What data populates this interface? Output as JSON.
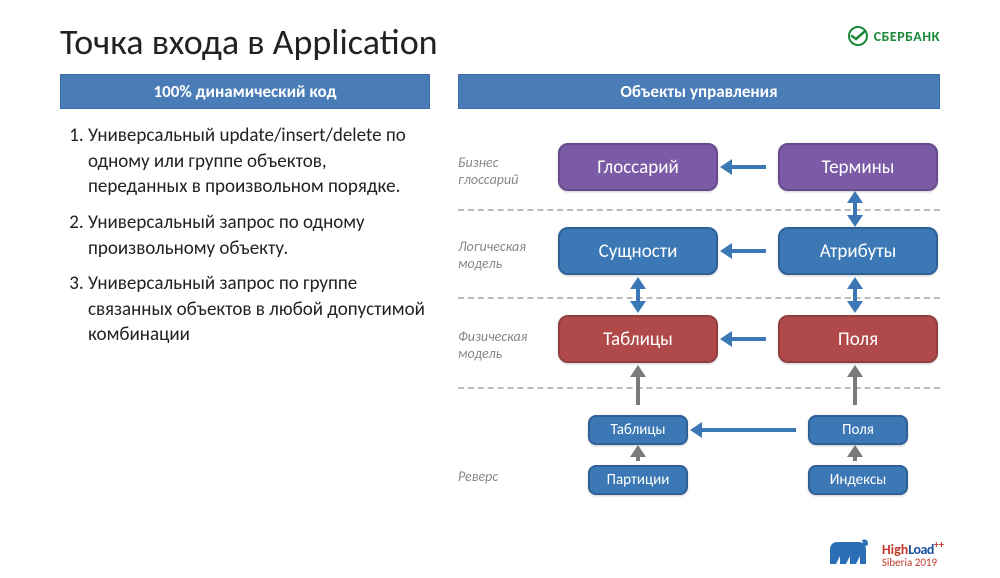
{
  "title": "Точка входа в Application",
  "brand": {
    "name": "СБЕРБАНК"
  },
  "left": {
    "header": "100% динамический код",
    "items": [
      "Универсальный update/insert/delete по одному или группе объектов, переданных в произвольном порядке.",
      "Универсальный запрос по одному произвольному объекту.",
      "Универсальный запрос по группе связанных объектов в любой допустимой комбинации"
    ]
  },
  "right": {
    "header": "Объекты управления",
    "labels": {
      "biz": "Бизнес глоссарий",
      "logical": "Логическая модель",
      "physical": "Физическая модель",
      "reverse": "Реверс"
    },
    "boxes": {
      "glossary": "Глоссарий",
      "terms": "Термины",
      "entities": "Сущности",
      "attrs": "Атрибуты",
      "tables": "Таблицы",
      "fields": "Поля",
      "tables2": "Таблицы",
      "fields2": "Поля",
      "partitions": "Партиции",
      "indexes": "Индексы"
    }
  },
  "footer": {
    "hl_high": "High",
    "hl_load": "Load",
    "hl_plus": "++",
    "hl_sub": "Siberia 2019"
  }
}
